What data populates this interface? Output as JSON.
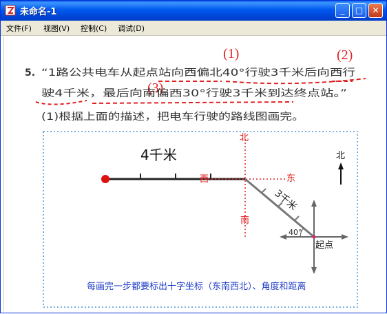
{
  "window": {
    "title": "未命名-1",
    "buttons": {
      "minimize": "_",
      "maximize": "□",
      "close": "✕"
    }
  },
  "menu": {
    "items": [
      "文件(F)",
      "视图(V)",
      "控制(C)",
      "调试(D)"
    ]
  },
  "content": {
    "problem_number": "5.",
    "problem_line1": "“1路公共电车从起点站向西偏北40°行驶3千米后向西行",
    "problem_line2": "驶4千米，最后向南偏西30°行驶3千米到达终点站。”",
    "question": "(1)根据上面的描述，把电车行驶的路线图画完。",
    "markers": [
      "(1)",
      "(2)",
      "(3)"
    ],
    "diagram": {
      "distance_4km": "4千米",
      "distance_3km": "3千米",
      "north": "北",
      "east": "东",
      "west": "西",
      "south": "南",
      "angle": "40°",
      "start_label": "起点",
      "compass_north": "北"
    },
    "note": "每画完一步都要标出十字坐标（东南西北）、角度和距离"
  }
}
